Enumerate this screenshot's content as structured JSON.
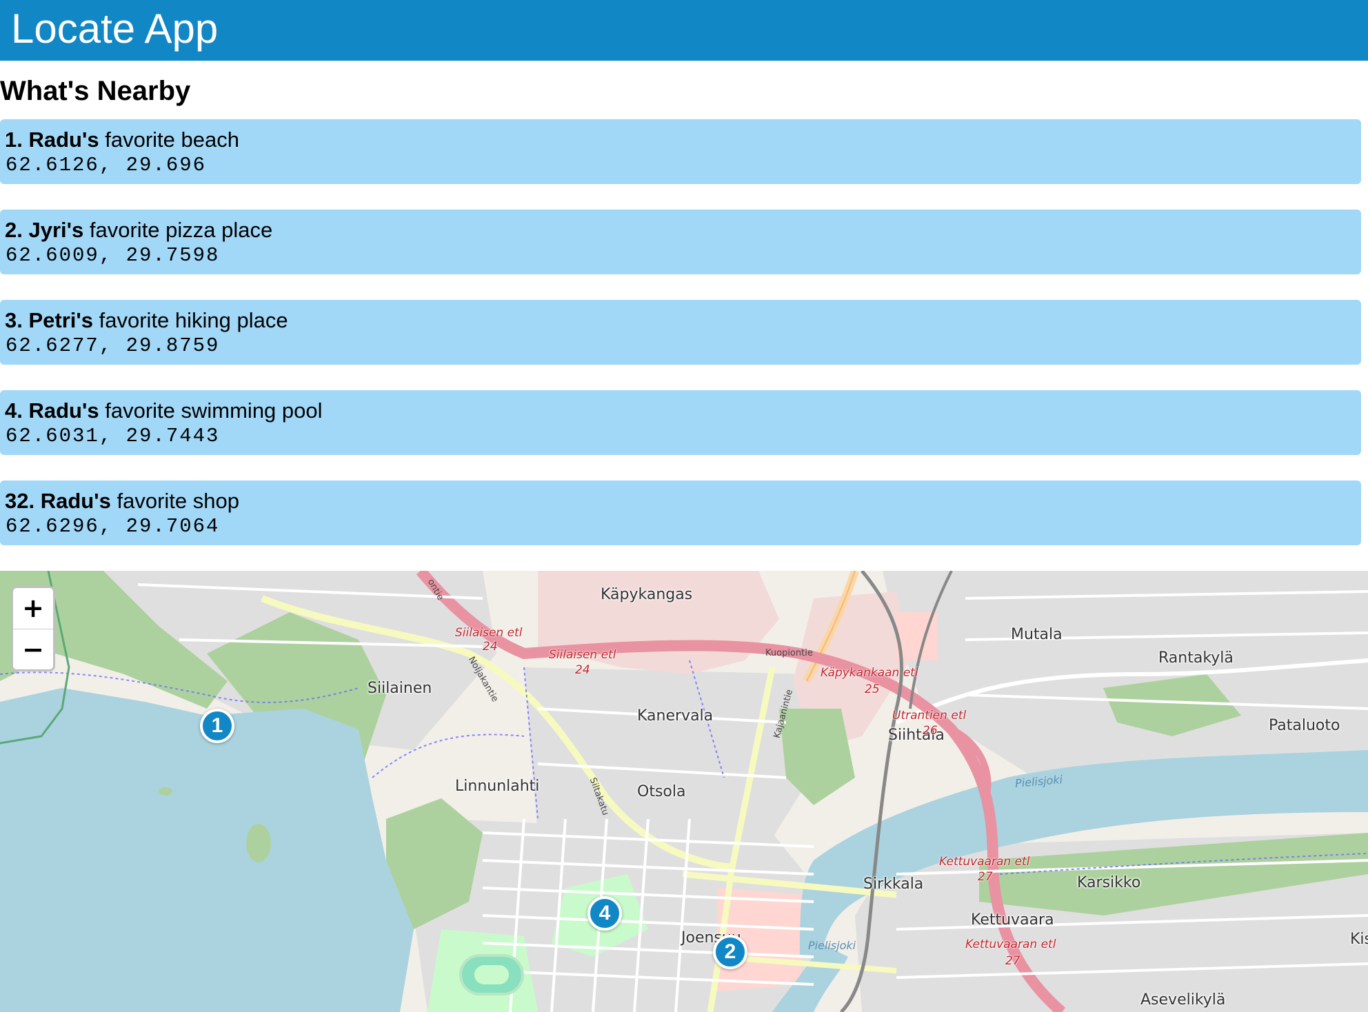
{
  "header": {
    "title": "Locate App",
    "color": "#1187c6"
  },
  "section": {
    "heading": "What's Nearby"
  },
  "places": [
    {
      "number": "1.",
      "owner": "Radu's",
      "description": "favorite beach",
      "coords": "62.6126, 29.696"
    },
    {
      "number": "2.",
      "owner": "Jyri's",
      "description": "favorite pizza place",
      "coords": "62.6009, 29.7598"
    },
    {
      "number": "3.",
      "owner": "Petri's",
      "description": "favorite hiking place",
      "coords": "62.6277, 29.8759"
    },
    {
      "number": "4.",
      "owner": "Radu's",
      "description": "favorite swimming pool",
      "coords": "62.6031, 29.7443"
    },
    {
      "number": "32.",
      "owner": "Radu's",
      "description": "favorite shop",
      "coords": "62.6296, 29.7064"
    }
  ],
  "list_item_color": "#a1d7f7",
  "map": {
    "zoom_in_label": "+",
    "zoom_out_label": "−",
    "markers": [
      {
        "label": "1"
      },
      {
        "label": "4"
      },
      {
        "label": "2"
      }
    ],
    "place_labels": {
      "kapykangas": "Käpykangas",
      "mutala": "Mutala",
      "rantakyla": "Rantakylä",
      "siilainen": "Siilainen",
      "kanervala": "Kanervala",
      "siihtala": "Siihtala",
      "pataluoto": "Pataluoto",
      "linnunlahti": "Linnunlahti",
      "otsola": "Otsola",
      "sirkkala": "Sirkkala",
      "karsikko": "Karsikko",
      "kettuvaara": "Kettuvaara",
      "joensuu": "Joensuu",
      "kis": "Kis",
      "asevelikyla": "Asevelikylä"
    },
    "road_labels": {
      "siilaisen_etl_a": "Siilaisen etl",
      "siilaisen_24_a": "24",
      "siilaisen_etl_b": "Siilaisen etl",
      "siilaisen_24_b": "24",
      "kuopiontie": "Kuopiontie",
      "kapykankaan_etl": "Käpykankaan etl",
      "kapykankaan_25": "25",
      "utrantien_etl": "Utrantien etl",
      "utrantien_26": "26",
      "kettuvaaran_etl_a": "Kettuvaaran etl",
      "kettuvaaran_27_a": "27",
      "kettuvaaran_etl_b": "Kettuvaaran etl",
      "kettuvaaran_27_b": "27"
    },
    "street_labels": {
      "noljakantie": "Noljakantie",
      "kajaanintie": "Kajaanintie",
      "siltakatu": "Siltakatu",
      "ontie": "ontie"
    },
    "water_labels": {
      "pielisjoki_a": "Pielisjoki",
      "pielisjoki_b": "Pielisjoki"
    },
    "colors": {
      "water": "#aad3df",
      "forest": "#add19e",
      "park": "#c8facc",
      "residential": "#e0dfdf",
      "commercial": "#f2dad9",
      "retail": "#ffd6d1",
      "trunk_road": "#e892a2",
      "primary_road": "#fcd6a4",
      "secondary_road": "#f7fabf"
    }
  }
}
